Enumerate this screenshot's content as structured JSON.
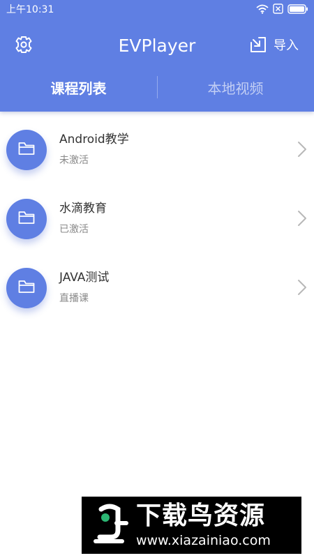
{
  "status_bar": {
    "time": "上午10:31",
    "icons": [
      "wifi-icon",
      "sim-blocked-icon",
      "battery-icon"
    ]
  },
  "toolbar": {
    "title": "EVPlayer",
    "settings_icon": "gear-icon",
    "import_icon": "import-icon",
    "import_label": "导入"
  },
  "tabs": [
    {
      "label": "课程列表",
      "active": true
    },
    {
      "label": "本地视频",
      "active": false
    }
  ],
  "courses": [
    {
      "name": "Android教学",
      "status": "未激活",
      "icon": "folder-icon"
    },
    {
      "name": "水滴教育",
      "status": "已激活",
      "icon": "folder-icon"
    },
    {
      "name": "JAVA测试",
      "status": "直播课",
      "icon": "folder-icon"
    }
  ],
  "watermark": {
    "title": "下载鸟资源",
    "url": "www.xiazainiao.com"
  },
  "colors": {
    "header": "#5f7fe3",
    "text_primary": "#333333",
    "text_secondary": "#888888",
    "chevron": "#b8b8b8"
  }
}
